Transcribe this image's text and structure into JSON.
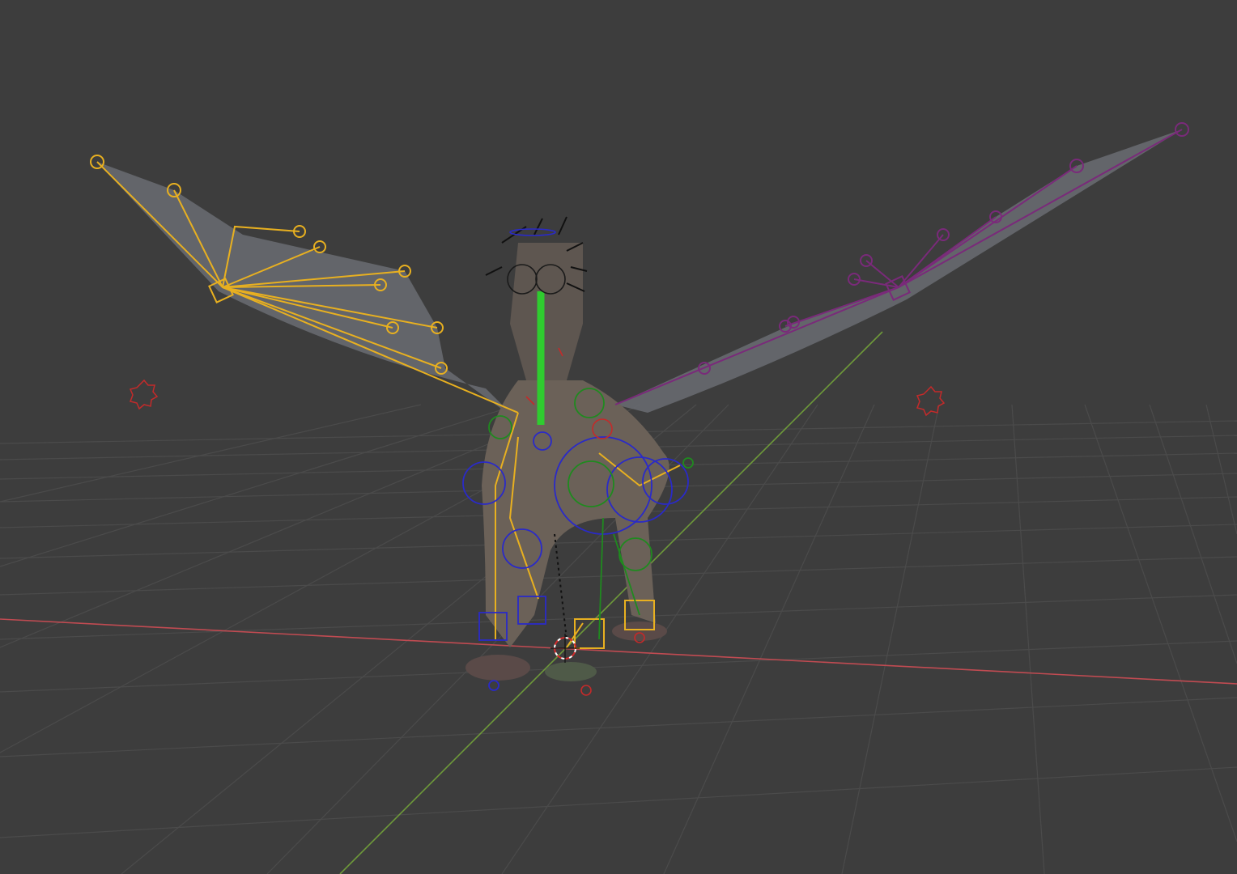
{
  "viewport": {
    "mode": "3D Viewport",
    "object": "dragon-rig",
    "icons": [
      "grid-floor-icon",
      "x-axis-icon",
      "y-axis-icon",
      "light-icon",
      "3d-cursor-icon",
      "armature-icon",
      "mesh-icon"
    ]
  },
  "colors": {
    "background": "#3d3d3d",
    "grid_line": "#4a4a4a",
    "x_axis": "#c14b52",
    "y_axis": "#6e9a3a",
    "bone_left": "#e8b020",
    "bone_right": "#7a2a7a",
    "bone_spine": "#2fcc2f",
    "ik_control": "#2a2ac8",
    "fk_control": "#1f8a1f",
    "light": "#c42a2a",
    "wing_membrane": "#6a6c72",
    "body": "#6b6158"
  }
}
